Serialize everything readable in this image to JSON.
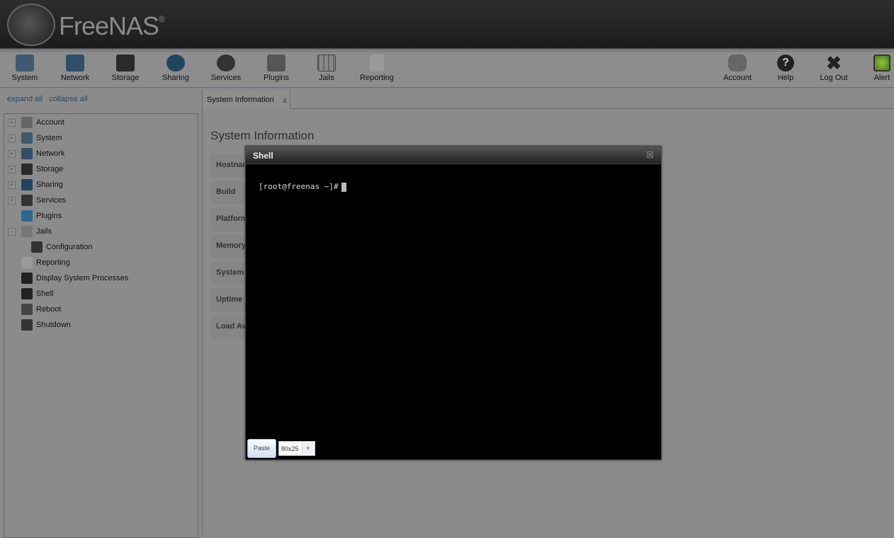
{
  "header": {
    "brand": "FreeNAS",
    "registered": "®"
  },
  "toolbar": {
    "left": [
      {
        "label": "System",
        "icon": "system-icon"
      },
      {
        "label": "Network",
        "icon": "network-icon"
      },
      {
        "label": "Storage",
        "icon": "storage-icon"
      },
      {
        "label": "Sharing",
        "icon": "sharing-icon"
      },
      {
        "label": "Services",
        "icon": "services-icon"
      },
      {
        "label": "Plugins",
        "icon": "plugins-icon"
      },
      {
        "label": "Jails",
        "icon": "jails-icon"
      },
      {
        "label": "Reporting",
        "icon": "reporting-icon"
      }
    ],
    "right": [
      {
        "label": "Account",
        "icon": "account-icon"
      },
      {
        "label": "Help",
        "icon": "help-icon"
      },
      {
        "label": "Log Out",
        "icon": "logout-icon"
      },
      {
        "label": "Alert",
        "icon": "alert-icon",
        "color": "#6fa82a"
      }
    ]
  },
  "tree": {
    "expand_all": "expand all",
    "collapse_all": "collapse all",
    "items": [
      {
        "label": "Account",
        "toggle": "+"
      },
      {
        "label": "System",
        "toggle": "+"
      },
      {
        "label": "Network",
        "toggle": "+"
      },
      {
        "label": "Storage",
        "toggle": "+"
      },
      {
        "label": "Sharing",
        "toggle": "+"
      },
      {
        "label": "Services",
        "toggle": "+"
      },
      {
        "label": "Plugins",
        "toggle": ""
      },
      {
        "label": "Jails",
        "toggle": "−"
      },
      {
        "label": "Configuration",
        "toggle": ""
      },
      {
        "label": "Reporting",
        "toggle": ""
      },
      {
        "label": "Display System Processes",
        "toggle": ""
      },
      {
        "label": "Shell",
        "toggle": ""
      },
      {
        "label": "Reboot",
        "toggle": ""
      },
      {
        "label": "Shutdown",
        "toggle": ""
      }
    ]
  },
  "tab": {
    "label": "System Information",
    "close": "x"
  },
  "page": {
    "title": "System Information",
    "rows": [
      "Hostname",
      "Build",
      "Platform",
      "Memory",
      "System Time",
      "Uptime",
      "Load Average"
    ]
  },
  "shell": {
    "title": "Shell",
    "close": "☒",
    "prompt": "[root@freenas ~]#",
    "paste": "Paste",
    "size": "80x25",
    "size_arrow": "▼"
  }
}
